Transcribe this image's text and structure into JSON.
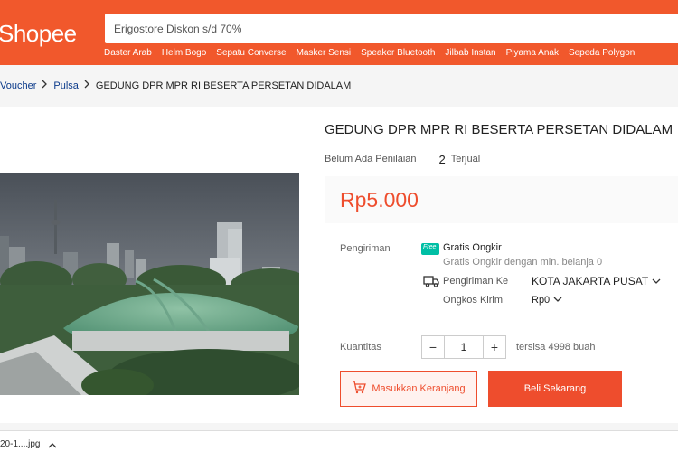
{
  "header": {
    "logo": "Shopee",
    "search_placeholder": "Erigostore Diskon s/d 70%",
    "hotwords": [
      "Daster Arab",
      "Helm Bogo",
      "Sepatu Converse",
      "Masker Sensi",
      "Speaker Bluetooth",
      "Jilbab Instan",
      "Piyama Anak",
      "Sepeda Polygon"
    ]
  },
  "breadcrumb": {
    "items": [
      "Voucher",
      "Pulsa"
    ],
    "current": "GEDUNG DPR MPR RI BESERTA PERSETAN DIDALAM"
  },
  "product": {
    "title": "GEDUNG DPR MPR RI BESERTA PERSETAN DIDALAM",
    "rating_text": "Belum Ada Penilaian",
    "sold_count": "2",
    "sold_label": "Terjual",
    "price": "Rp5.000"
  },
  "shipping": {
    "label": "Pengiriman",
    "free_badge": "Free",
    "free_title": "Gratis Ongkir",
    "free_sub": "Gratis Ongkir dengan min. belanja 0",
    "dest_label": "Pengiriman Ke",
    "dest_value": "KOTA JAKARTA PUSAT",
    "cost_label": "Ongkos Kirim",
    "cost_value": "Rp0"
  },
  "quantity": {
    "label": "Kuantitas",
    "minus": "−",
    "plus": "+",
    "value": "1",
    "stock": "tersisa 4998 buah"
  },
  "actions": {
    "cart_label": "Masukkan Keranjang",
    "buy_label": "Beli Sekarang"
  },
  "download": {
    "filename": "20-1....jpg"
  },
  "colors": {
    "brand": "#ee4d2d",
    "header": "#f1582c",
    "free_badge": "#00bfa5"
  },
  "icons": [
    "chevron-right-icon",
    "free-shipping-icon",
    "truck-icon",
    "chevron-down-icon",
    "cart-icon",
    "chevron-up-icon"
  ]
}
